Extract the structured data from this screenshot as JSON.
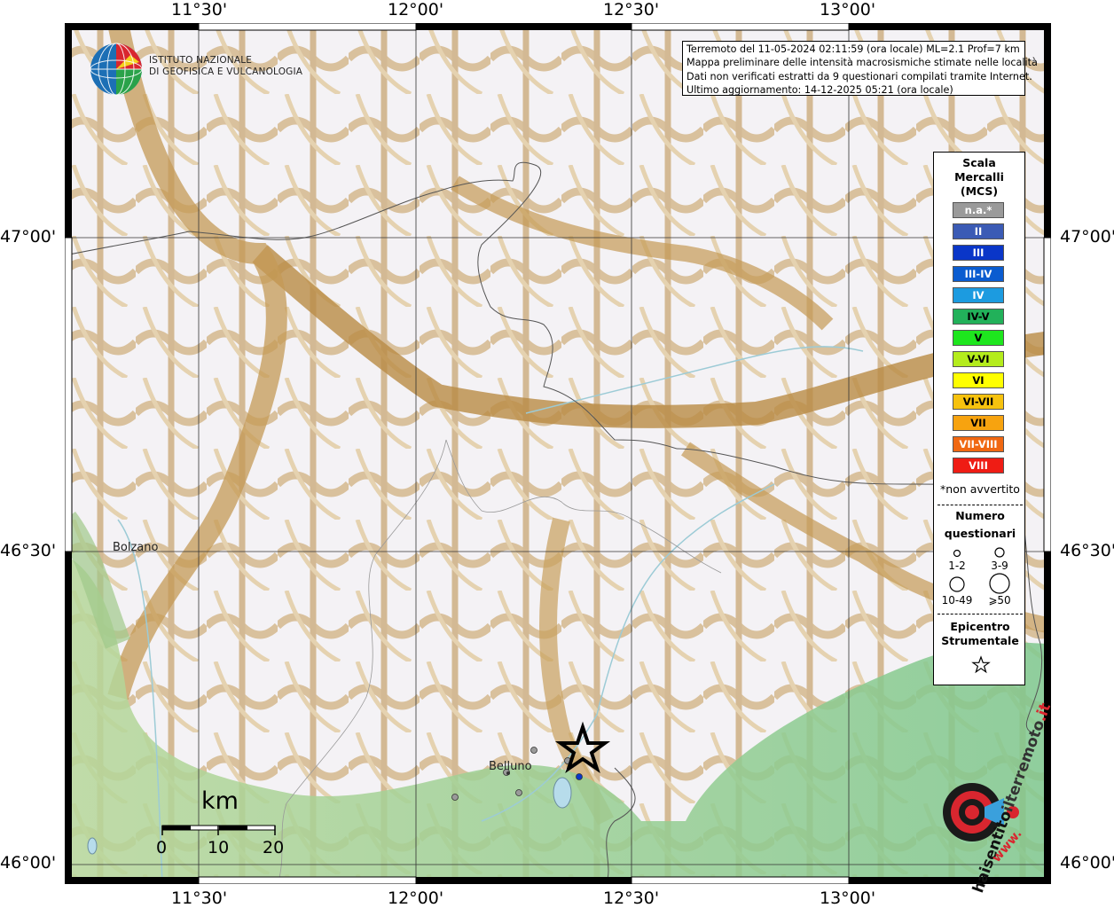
{
  "axes": {
    "top_labels": [
      "11°30'",
      "12°00'",
      "12°30'",
      "13°00'"
    ],
    "bottom_labels": [
      "11°30'",
      "12°00'",
      "12°30'",
      "13°00'"
    ],
    "left_labels": [
      "47°00'",
      "46°30'",
      "46°00'"
    ],
    "right_labels": [
      "47°00'",
      "46°30'",
      "46°00'"
    ]
  },
  "info": {
    "line1": "Terremoto del 11-05-2024 02:11:59 (ora locale) ML=2.1 Prof=7 km",
    "line2": "Mappa preliminare delle intensità macrosismiche stimate nelle località",
    "line3": "Dati non verificati estratti da 9 questionari compilati tramite Internet.",
    "line4": "Ultimo aggiornamento: 14-12-2025 05:21 (ora locale)"
  },
  "logo": {
    "line1": "Istituto Nazionale",
    "line2": "di Geofisica e Vulcanologia"
  },
  "legend": {
    "title1": "Scala",
    "title2": "Mercalli",
    "title3": "(MCS)",
    "scale": [
      {
        "label": "n.a.*",
        "color": "#9a9a9a",
        "text": "#ffffff"
      },
      {
        "label": "II",
        "color": "#3b5bb5",
        "text": "#ffffff"
      },
      {
        "label": "III",
        "color": "#0a36c8",
        "text": "#ffffff"
      },
      {
        "label": "III-IV",
        "color": "#0a5cd0",
        "text": "#ffffff"
      },
      {
        "label": "IV",
        "color": "#1c9be0",
        "text": "#ffffff"
      },
      {
        "label": "IV-V",
        "color": "#22b15a",
        "text": "#000000"
      },
      {
        "label": "V",
        "color": "#1ee61e",
        "text": "#000000"
      },
      {
        "label": "V-VI",
        "color": "#b4ec1c",
        "text": "#000000"
      },
      {
        "label": "VI",
        "color": "#ffff00",
        "text": "#000000"
      },
      {
        "label": "VI-VII",
        "color": "#f6c20e",
        "text": "#000000"
      },
      {
        "label": "VII",
        "color": "#f7a30f",
        "text": "#000000"
      },
      {
        "label": "VII-VIII",
        "color": "#f06812",
        "text": "#ffffff"
      },
      {
        "label": "VIII",
        "color": "#ef1c14",
        "text": "#ffffff"
      }
    ],
    "note": "*non avvertito",
    "numero1": "Numero",
    "numero2": "questionari",
    "q_labels": [
      "1-2",
      "3-9",
      "10-49",
      "⩾50"
    ],
    "epi1": "Epicentro",
    "epi2": "Strumentale"
  },
  "places": {
    "bolzano": "Bolzano",
    "belluno": "Belluno"
  },
  "scalebar": {
    "unit": "km",
    "ticks": [
      "0",
      "10",
      "20"
    ]
  },
  "watermark": {
    "text1": "haisentito",
    "text2": "ilterremoto",
    "text3": ".it",
    "text4": "www."
  }
}
